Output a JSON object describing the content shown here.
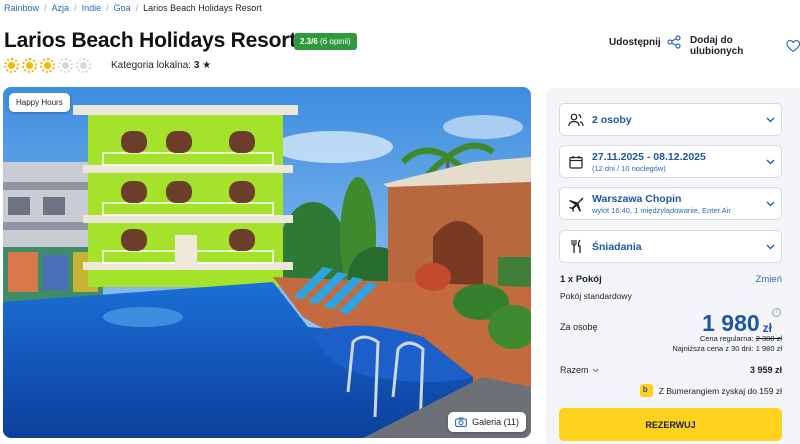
{
  "breadcrumb": [
    "Rainbow",
    "Azja",
    "Indie",
    "Goa",
    "Larios Beach Holidays Resort"
  ],
  "hotel": {
    "name": "Larios Beach Holidays Resort",
    "rating": "2.3/6",
    "rating_count": "(6 opinii)",
    "sun_rating": 3,
    "sun_max": 5,
    "local_category_label": "Kategoria lokalna:",
    "local_category_value": "3"
  },
  "actions": {
    "share": "Udostępnij",
    "favorite": "Dodaj do ulubionych"
  },
  "photo": {
    "badge": "Happy Hours",
    "gallery": "Galeria (11)"
  },
  "booking": {
    "guests": "2 osoby",
    "dates": "27.11.2025 - 08.12.2025",
    "dates_sub": "(12 dni / 10 noclegów)",
    "departure": "Warszawa Chopin",
    "departure_sub": "wylot 16:40, 1 międzylądowanie, Enter Air",
    "board": "Śniadania",
    "rooms": "1 x Pokój",
    "change": "Zmień",
    "room_type": "Pokój standardowy",
    "per_person_label": "Za osobę",
    "price": "1 980",
    "currency": "zł",
    "regular_label": "Cena regularna:",
    "regular_price": "2 380 zł",
    "lowest_30": "Najniższa cena z 30 dni: 1 980 zł",
    "total_label": "Razem",
    "total_value": "3 959 zł",
    "bumerang": "Z Bumerangiem zyskaj do 159 zł",
    "reserve": "REZERWUJ"
  },
  "colors": {
    "accent": "#1e55a8",
    "rating_badge": "#2e9a3d",
    "reserve_button": "#ffd21e",
    "sun": "#f5b800"
  }
}
